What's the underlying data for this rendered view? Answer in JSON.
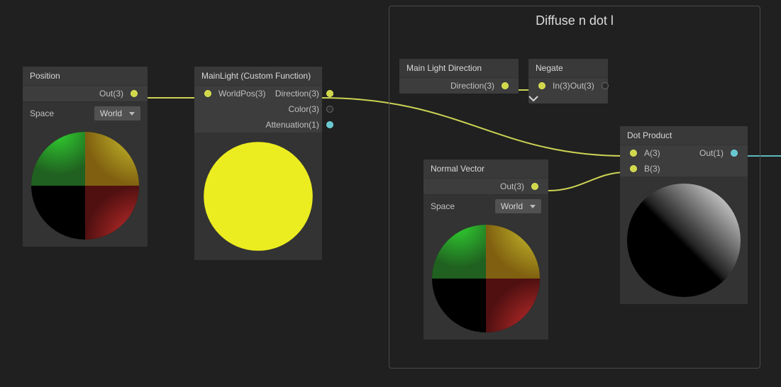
{
  "group": {
    "title": "Diffuse n dot l"
  },
  "nodes": {
    "position": {
      "title": "Position",
      "out": "Out(3)",
      "space_label": "Space",
      "space_value": "World"
    },
    "mainlight": {
      "title": "MainLight (Custom Function)",
      "in_worldpos": "WorldPos(3)",
      "out_direction": "Direction(3)",
      "out_color": "Color(3)",
      "out_attenuation": "Attenuation(1)"
    },
    "mld": {
      "title": "Main Light Direction",
      "out": "Direction(3)"
    },
    "negate": {
      "title": "Negate",
      "in": "In(3)",
      "out": "Out(3)"
    },
    "normal": {
      "title": "Normal Vector",
      "out": "Out(3)",
      "space_label": "Space",
      "space_value": "World"
    },
    "dot": {
      "title": "Dot Product",
      "in_a": "A(3)",
      "in_b": "B(3)",
      "out": "Out(1)"
    }
  }
}
